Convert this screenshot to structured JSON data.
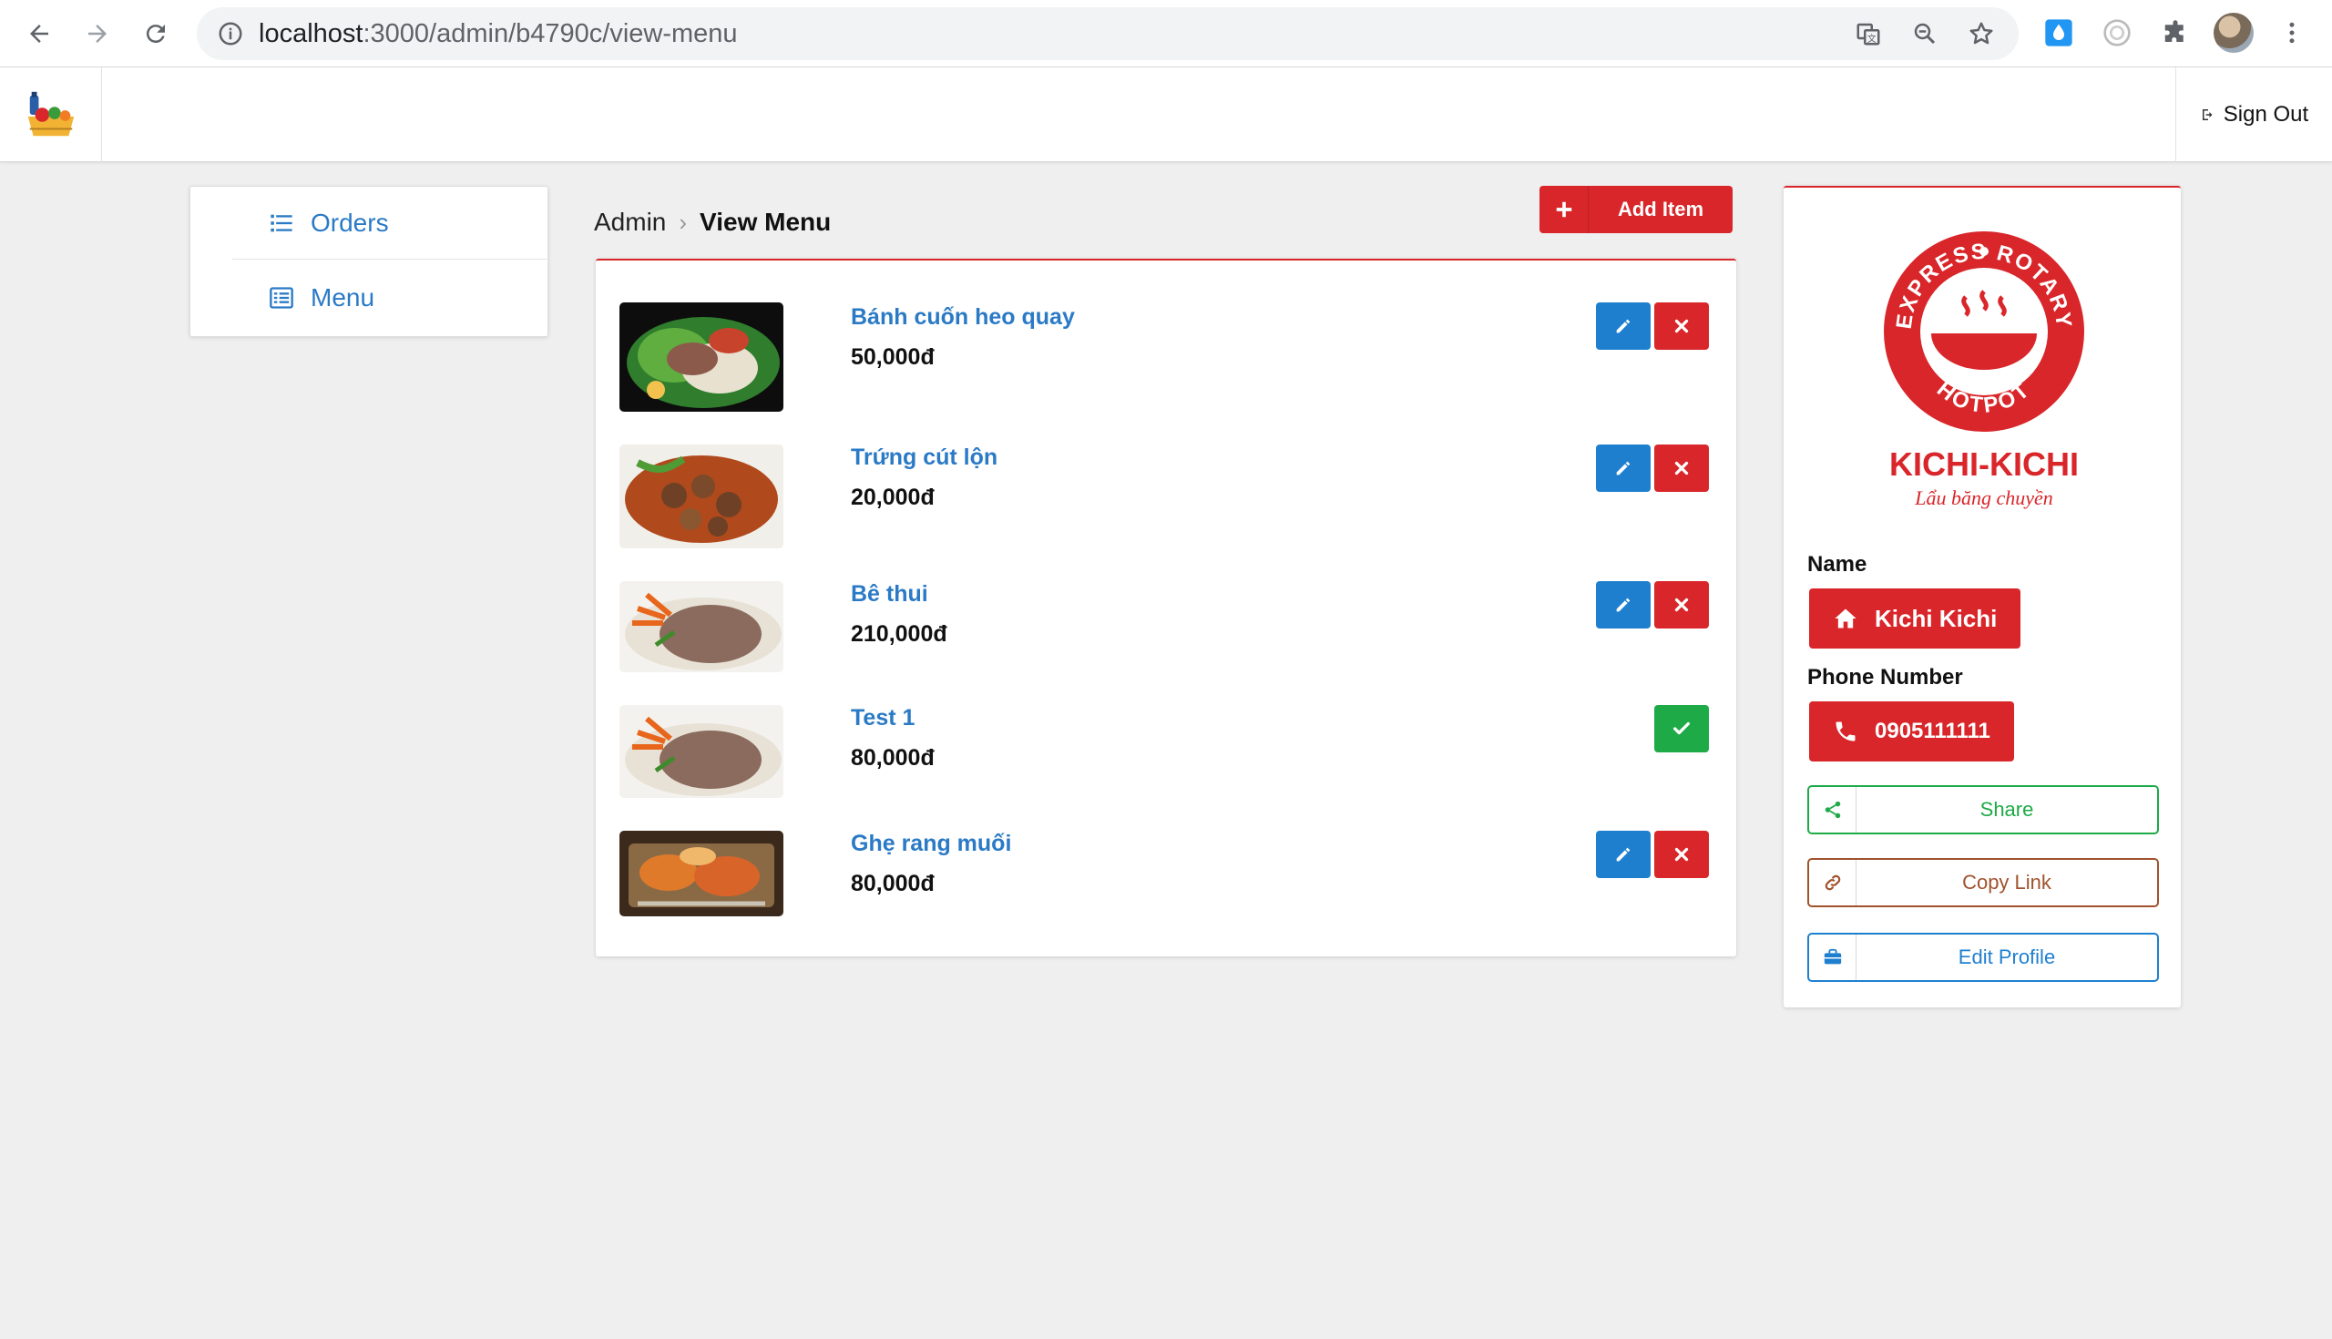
{
  "browser": {
    "url_host": "localhost",
    "url_path": ":3000/admin/b4790c/view-menu",
    "icons": [
      "back-icon",
      "forward-icon",
      "reload-icon",
      "info-icon",
      "translate-icon",
      "zoom-icon",
      "star-icon",
      "extension-drop-icon",
      "extension-circle-icon",
      "puzzle-icon",
      "kebab-icon"
    ]
  },
  "topbar": {
    "signout_label": "Sign Out"
  },
  "sidebar": {
    "items": [
      {
        "label": "Orders",
        "icon": "list-icon"
      },
      {
        "label": "Menu",
        "icon": "list-alt-icon"
      }
    ]
  },
  "breadcrumb": {
    "root": "Admin",
    "separator": "›",
    "current": "View Menu"
  },
  "add_item_label": "Add Item",
  "menu_items": [
    {
      "name": "Bánh cuốn heo quay",
      "price": "50,000đ",
      "actions": [
        "edit",
        "delete"
      ]
    },
    {
      "name": "Trứng cút lộn",
      "price": "20,000đ",
      "actions": [
        "edit",
        "delete"
      ]
    },
    {
      "name": "Bê thui",
      "price": "210,000đ",
      "actions": [
        "edit",
        "delete"
      ]
    },
    {
      "name": "Test 1",
      "price": "80,000đ",
      "actions": [
        "restore"
      ]
    },
    {
      "name": "Ghẹ rang muối",
      "price": "80,000đ",
      "actions": [
        "edit",
        "delete"
      ]
    }
  ],
  "profile": {
    "logo_ring_top": "EXPRESS  ROTARY",
    "logo_ring_bottom": "HOTPOT",
    "logo_brand": "KICHI-KICHI",
    "logo_tagline": "Lẩu băng chuyền",
    "name_label": "Name",
    "name_value": "Kichi Kichi",
    "phone_label": "Phone Number",
    "phone_value": "0905111111",
    "share_label": "Share",
    "copy_link_label": "Copy Link",
    "edit_profile_label": "Edit Profile"
  },
  "colors": {
    "accent_red": "#d9262a",
    "link_blue": "#2a7ac6",
    "button_blue": "#1f7fcf",
    "success_green": "#1eaa46",
    "copy_brown": "#a0522d"
  }
}
